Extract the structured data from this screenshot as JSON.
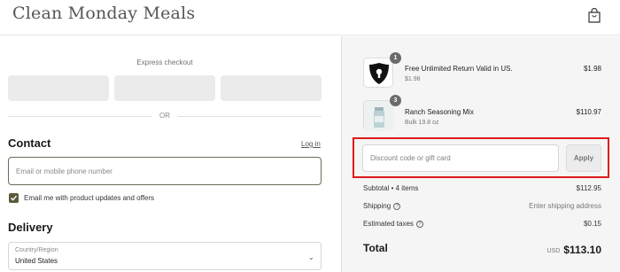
{
  "header": {
    "logo": "Clean Monday Meals",
    "cart_icon": "shopping-bag-icon"
  },
  "express": {
    "label": "Express checkout",
    "or": "OR"
  },
  "contact": {
    "title": "Contact",
    "login": "Log in",
    "email_placeholder": "Email or mobile phone number",
    "newsletter_label": "Email me with product updates and offers",
    "newsletter_checked": true
  },
  "delivery": {
    "title": "Delivery",
    "country_label": "Country/Region",
    "country_value": "United States"
  },
  "summary": {
    "items": [
      {
        "name": "Free Unlimited Return Valid in US.",
        "sub": "$1.98",
        "price": "$1.98",
        "qty": "1"
      },
      {
        "name": "Ranch Seasoning Mix",
        "sub": "Bulk 19.8 oz",
        "price": "$110.97",
        "qty": "3"
      }
    ],
    "discount_placeholder": "Discount code or gift card",
    "apply": "Apply",
    "subtotal_label": "Subtotal • 4 items",
    "subtotal_value": "$112.95",
    "shipping_label": "Shipping",
    "shipping_value": "Enter shipping address",
    "taxes_label": "Estimated taxes",
    "taxes_value": "$0.15",
    "total_label": "Total",
    "currency": "USD",
    "total_value": "$113.10"
  },
  "colors": {
    "accent": "#5b5a3c",
    "highlight": "#e01b1b"
  }
}
